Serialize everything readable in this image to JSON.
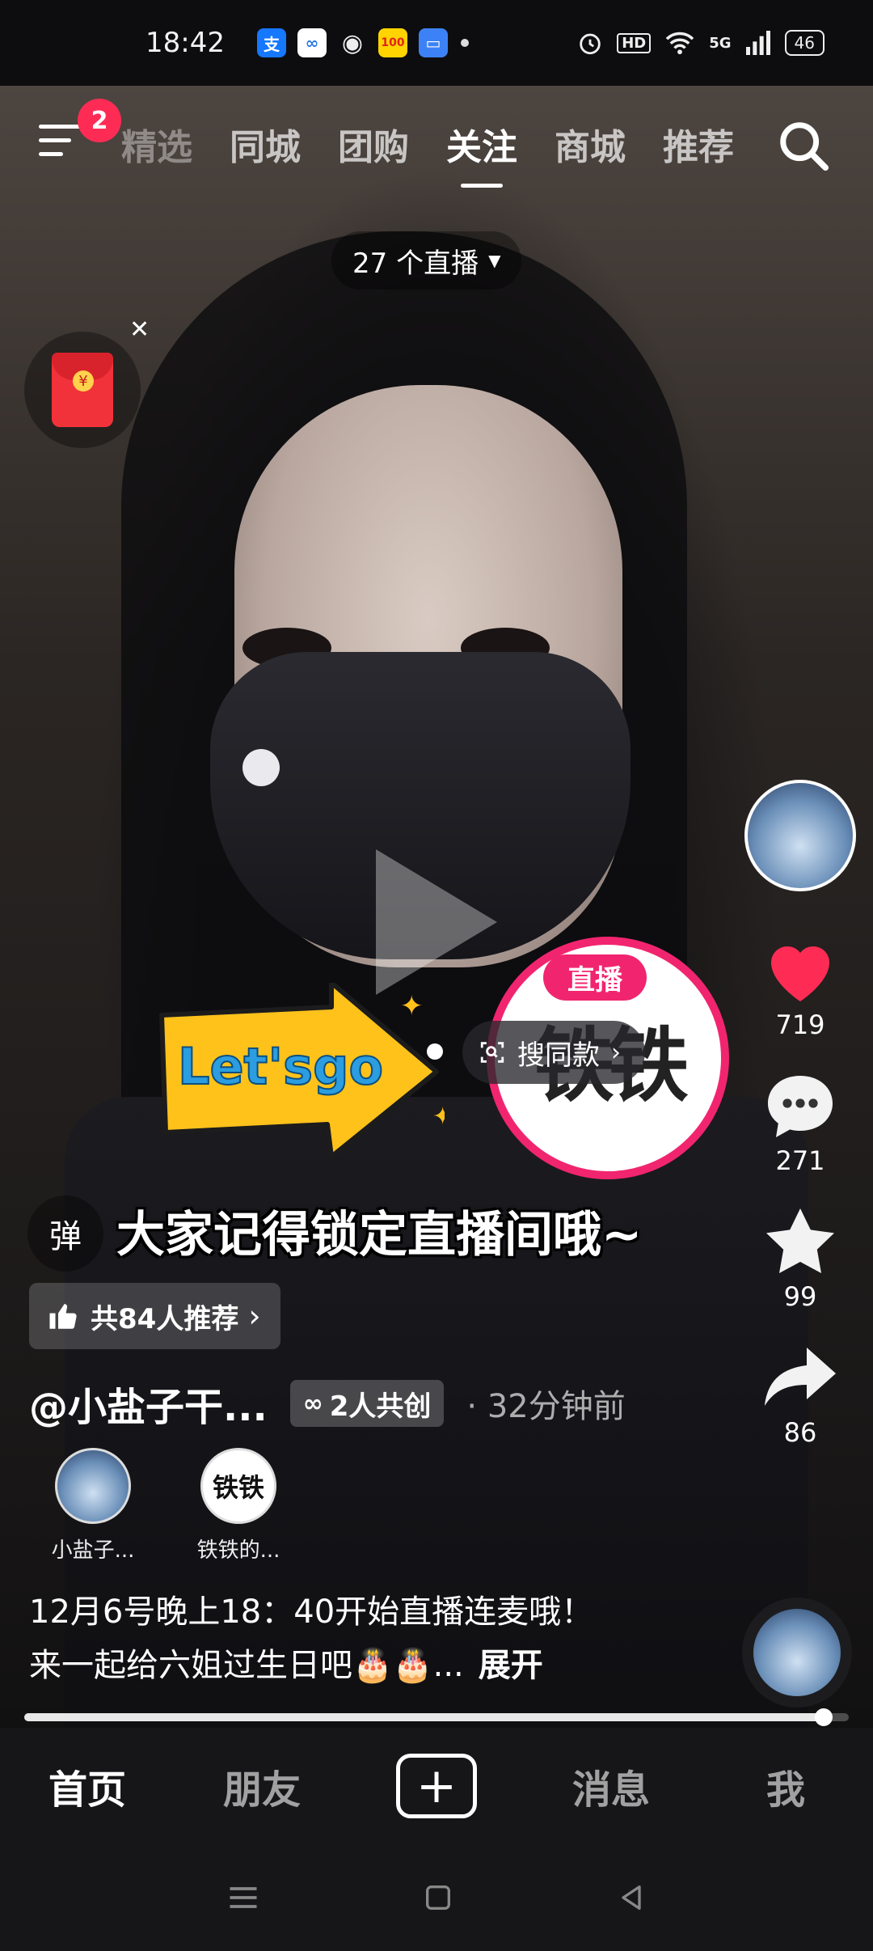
{
  "status_bar": {
    "time": "18:42",
    "apps": [
      "支",
      "∞",
      "◉",
      "100",
      "▭"
    ],
    "hd": "HD",
    "network": "5G",
    "battery": "46"
  },
  "top_nav": {
    "badge": "2",
    "tabs": [
      {
        "label": "精选",
        "active": false
      },
      {
        "label": "同城",
        "active": false
      },
      {
        "label": "团购",
        "active": false
      },
      {
        "label": "关注",
        "active": true
      },
      {
        "label": "商城",
        "active": false
      },
      {
        "label": "推荐",
        "active": false
      }
    ]
  },
  "live_count": "27 个直播",
  "stickers": {
    "letsgo_text": "Let'sgo",
    "live_tag": "直播",
    "live_text": "铁铁",
    "search_same": "搜同款"
  },
  "danmu": {
    "button": "弹",
    "text": "大家记得锁定直播间哦~"
  },
  "recommend": "共84人推荐",
  "author": {
    "name": "@小盐子干...",
    "cocreate": "2人共创",
    "time_ago": "· 32分钟前"
  },
  "creators": [
    {
      "name": "小盐子...",
      "avatar": "anime"
    },
    {
      "name": "铁铁的...",
      "avatar_text": "铁铁"
    }
  ],
  "description": {
    "line1": "12月6号晚上18：40开始直播连麦哦！",
    "line2": "来一起给六姐过生日吧🎂🎂...",
    "more": "展开"
  },
  "rail": {
    "likes": "719",
    "comments": "271",
    "favorites": "99",
    "shares": "86"
  },
  "progress": 0.97,
  "bottom_nav": {
    "home": "首页",
    "friends": "朋友",
    "plus": "+",
    "messages": "消息",
    "me": "我"
  },
  "colors": {
    "accent": "#fe2c55",
    "like": "#fe2c55",
    "live_ring": "#f1256f"
  }
}
